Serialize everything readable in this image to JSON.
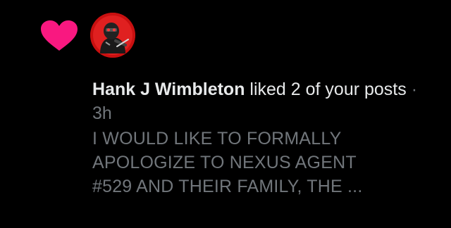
{
  "notification": {
    "type_icon": "heart-icon",
    "heart_color": "#f91880",
    "avatar_icon": "hooded-character-avatar",
    "user_name": "Hank J Wimbleton",
    "action_text": " liked 2 of your posts",
    "separator": " · ",
    "time_ago": "3h",
    "preview_line1": "I WOULD LIKE TO FORMALLY",
    "preview_line2": "APOLOGIZE TO NEXUS AGENT",
    "preview_line3": "#529 AND THEIR FAMILY, THE ..."
  },
  "colors": {
    "background": "#000000",
    "primary_text": "#e7e9ea",
    "secondary_text": "#71767b",
    "avatar_ring": "#c81010"
  }
}
